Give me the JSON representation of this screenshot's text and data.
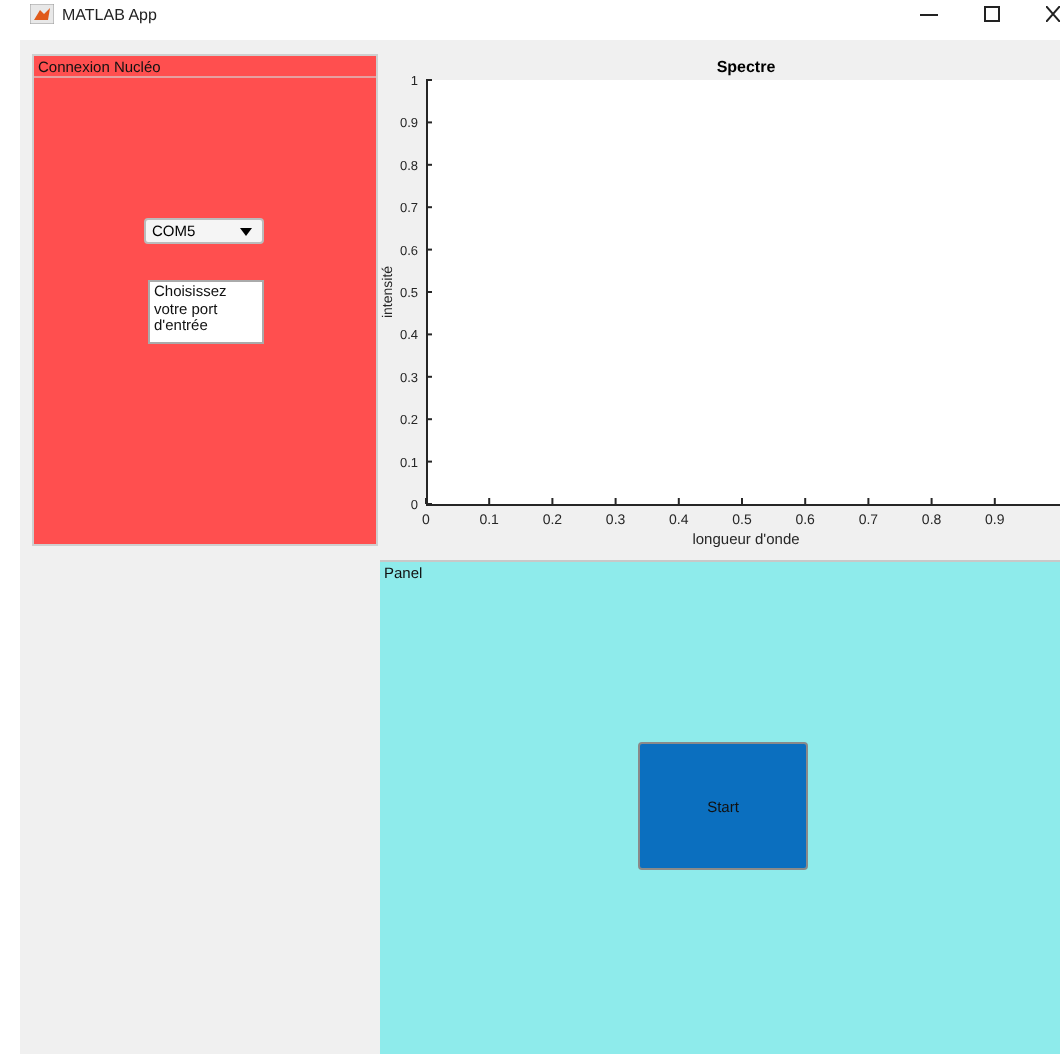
{
  "window": {
    "title": "MATLAB App"
  },
  "connection_panel": {
    "title": "Connexion Nucléo",
    "port_dropdown": {
      "value": "COM5"
    },
    "hint_box": {
      "value": "Choisissez votre port d'entrée"
    }
  },
  "spectrum": {
    "chart_data": {
      "type": "line",
      "title": "Spectre",
      "xlabel": "longueur d'onde",
      "ylabel": "intensité",
      "xlim": [
        0,
        1
      ],
      "ylim": [
        0,
        1
      ],
      "xticks": [
        0,
        0.1,
        0.2,
        0.3,
        0.4,
        0.5,
        0.6,
        0.7,
        0.8,
        0.9
      ],
      "yticks": [
        0,
        0.1,
        0.2,
        0.3,
        0.4,
        0.5,
        0.6,
        0.7,
        0.8,
        0.9,
        1
      ]
    }
  },
  "control_panel": {
    "title": "Panel",
    "start_button": {
      "label": "Start"
    }
  }
}
